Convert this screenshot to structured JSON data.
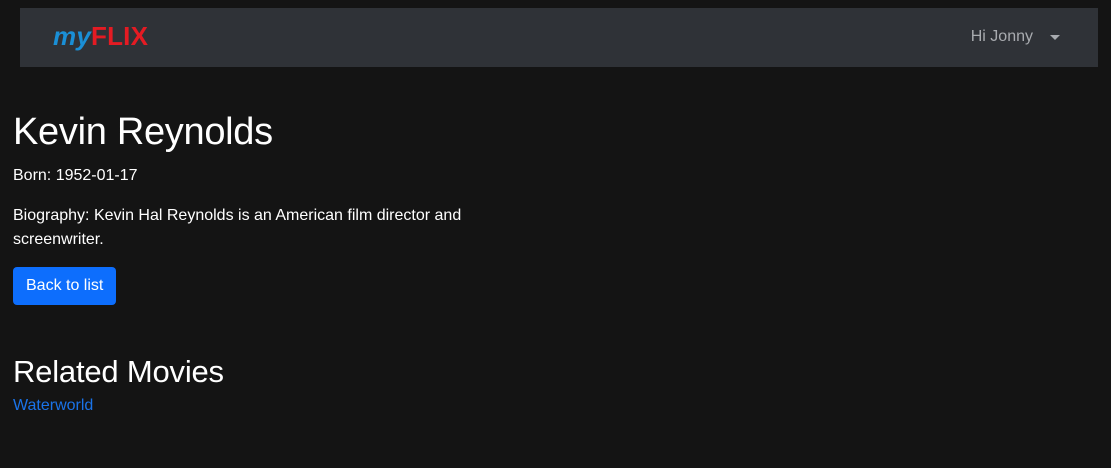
{
  "navbar": {
    "brand_prefix": "my",
    "brand_suffix": "FLIX",
    "user_greeting": "Hi Jonny"
  },
  "director": {
    "name": "Kevin Reynolds",
    "born_label": "Born: ",
    "born_date": "1952-01-17",
    "bio_label": "Biography: ",
    "bio_text": "Kevin Hal Reynolds is an American film director and screenwriter."
  },
  "actions": {
    "back_label": "Back to list"
  },
  "related": {
    "heading": "Related Movies",
    "movies": [
      {
        "title": "Waterworld"
      }
    ]
  },
  "colors": {
    "background": "#141414",
    "navbar": "#2f3237",
    "brand_my": "#1a8fd6",
    "brand_flix": "#e41b23",
    "primary_button": "#0d6efd",
    "link": "#1a73e8"
  },
  "icons": {
    "user_menu_toggle": "caret-down-icon"
  }
}
